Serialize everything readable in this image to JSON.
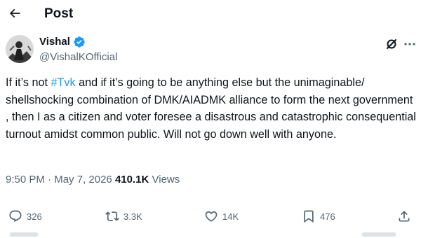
{
  "header": {
    "title": "Post"
  },
  "author": {
    "name": "Vishal",
    "handle": "@VishalKOfficial"
  },
  "tweet": {
    "pre": "If it’s not ",
    "hashtag": "#Tvk",
    "post": " and if it’s going to be anything else but the unimaginable/ shellshocking combination of DMK/AIADMK alliance to form the next government , then I as a citizen and voter foresee a disastrous and catastrophic consequential turnout amidst common public.  Will not go down well with anyone."
  },
  "meta": {
    "time": "9:50 PM",
    "separator": " · ",
    "date": "May 7, 2026",
    "views_count": "410.1K",
    "views_label": "Views"
  },
  "actions": {
    "replies": "326",
    "reposts": "3.3K",
    "likes": "14K",
    "bookmarks": "476"
  },
  "colors": {
    "accent": "#1d9bf0",
    "text": "#0f1419",
    "muted": "#536471"
  }
}
